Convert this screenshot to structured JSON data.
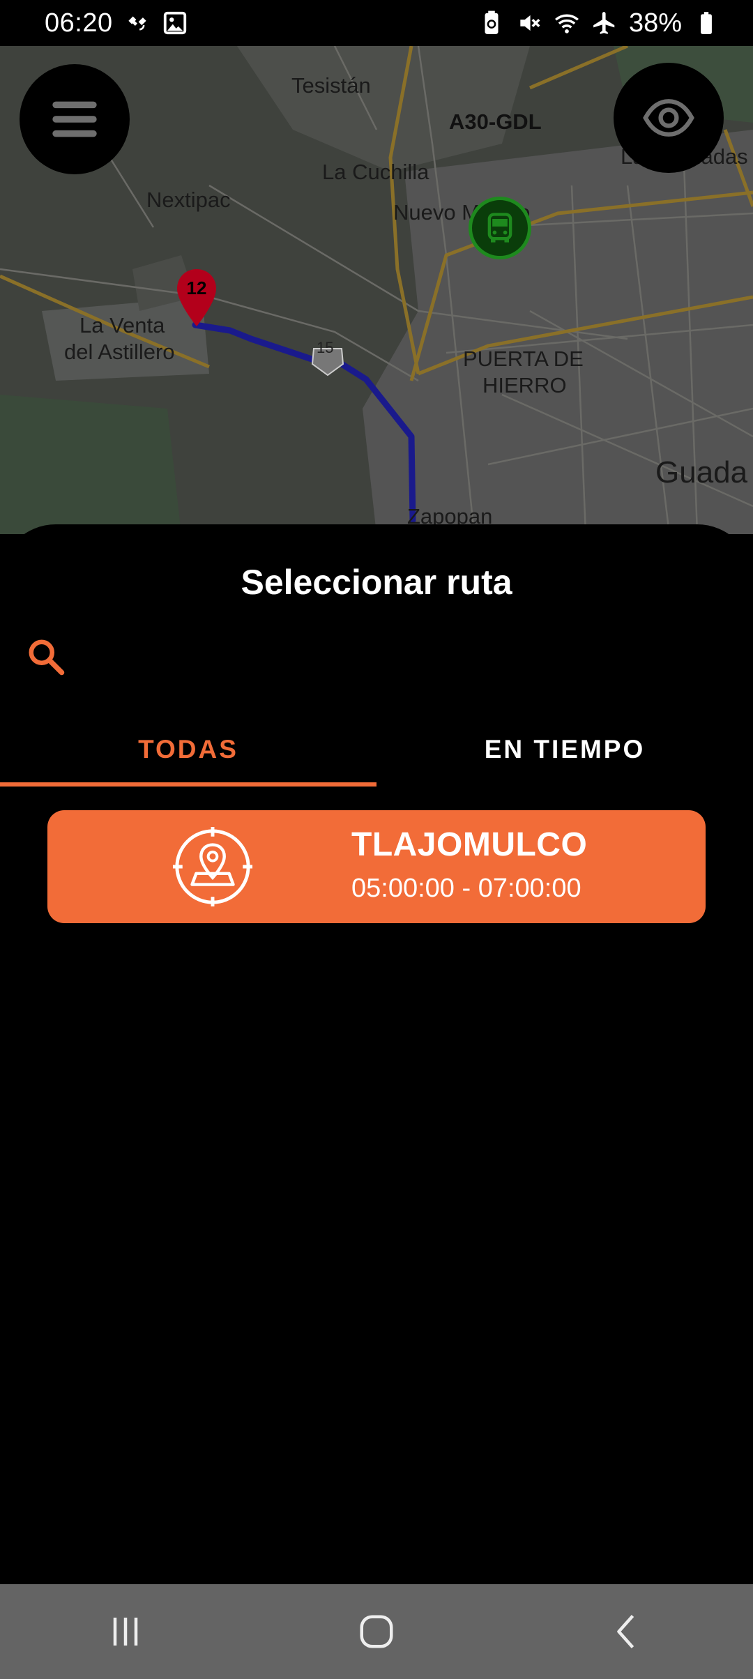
{
  "status_bar": {
    "time": "06:20",
    "battery_percent": "38%",
    "left_icons": [
      "satellite-icon",
      "image-icon"
    ],
    "right_icons": [
      "battery-saver-icon",
      "mute-icon",
      "wifi-icon",
      "airplane-icon",
      "battery-icon"
    ]
  },
  "map": {
    "labels": {
      "tesistan": "Tesistán",
      "la_cuchilla": "La Cuchilla",
      "nextipac": "Nextipac",
      "nuevo_mexico": "Nuevo México",
      "la_venta": "La Venta",
      "del_astillero": "del Astillero",
      "puerta_de": "PUERTA DE",
      "hierro": "HIERRO",
      "guada": "Guada",
      "zapopan": "Zapopan",
      "las_canadas": "Las Cañadas",
      "vehicle": "A30-GDL",
      "highway": "15"
    },
    "marker_number": "12",
    "colors": {
      "route": "#1a1a8c",
      "marker": "#b3001b",
      "bus": "#1e8a1e"
    }
  },
  "sheet": {
    "title": "Seleccionar ruta",
    "search": {
      "placeholder": "",
      "value": ""
    },
    "tabs": [
      {
        "label": "TODAS",
        "active": true
      },
      {
        "label": "EN TIEMPO",
        "active": false
      }
    ],
    "routes": [
      {
        "name": "TLAJOMULCO",
        "schedule": "05:00:00 - 07:00:00"
      }
    ]
  },
  "colors": {
    "accent": "#f26c38",
    "background": "#000000",
    "nav_bar": "#646464"
  }
}
